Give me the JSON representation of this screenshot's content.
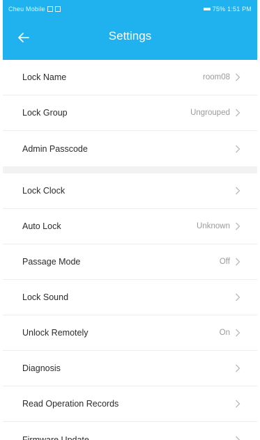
{
  "app": {
    "title": "Settings"
  },
  "colors": {
    "accent": "#1fb2ee",
    "label": "#2b2b2b",
    "value": "#9a9a9a"
  },
  "status_bar": {
    "left_text": "Cheu Mobile",
    "right_text": "75%  1:51 PM"
  },
  "groups": [
    [
      {
        "label": "Lock Name",
        "value": "room08"
      },
      {
        "label": "Lock Group",
        "value": "Ungrouped"
      },
      {
        "label": "Admin Passcode",
        "value": ""
      }
    ],
    [
      {
        "label": "Lock Clock",
        "value": ""
      },
      {
        "label": "Auto Lock",
        "value": "Unknown"
      },
      {
        "label": "Passage Mode",
        "value": "Off"
      },
      {
        "label": "Lock Sound",
        "value": ""
      },
      {
        "label": "Unlock Remotely",
        "value": "On"
      },
      {
        "label": "Diagnosis",
        "value": ""
      },
      {
        "label": "Read Operation Records",
        "value": ""
      },
      {
        "label": "Firmware Update",
        "value": ""
      }
    ]
  ]
}
